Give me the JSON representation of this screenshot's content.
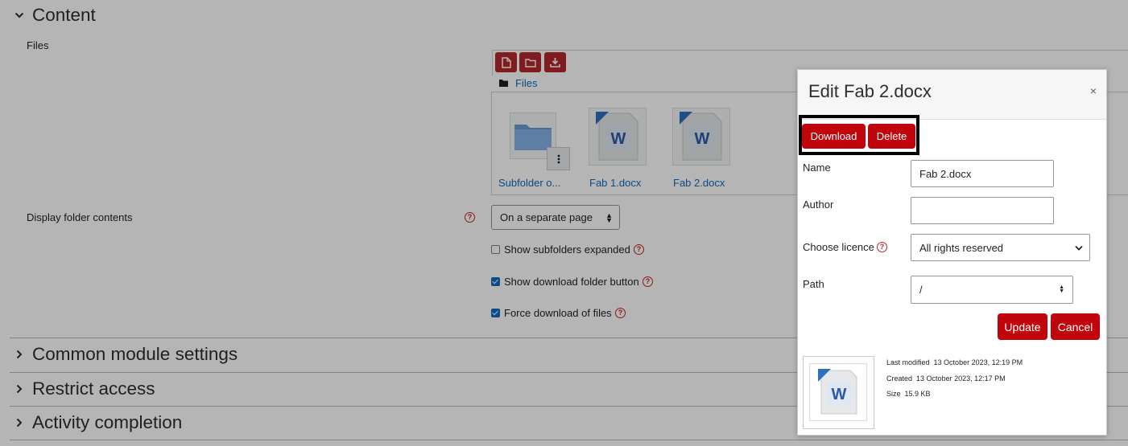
{
  "sections": {
    "content": "Content",
    "common": "Common module settings",
    "restrict": "Restrict access",
    "completion": "Activity completion"
  },
  "files_label": "Files",
  "filemanager": {
    "path": "Files",
    "items": [
      {
        "label": "Subfolder o...",
        "type": "folder"
      },
      {
        "label": "Fab 1.docx",
        "type": "docx"
      },
      {
        "label": "Fab 2.docx",
        "type": "docx"
      }
    ],
    "icons": [
      "add-file-icon",
      "create-folder-icon",
      "download-icon"
    ]
  },
  "display": {
    "label": "Display folder contents",
    "value": "On a separate page"
  },
  "checkboxes": [
    {
      "label": "Show subfolders expanded",
      "checked": false
    },
    {
      "label": "Show download folder button",
      "checked": true
    },
    {
      "label": "Force download of files",
      "checked": true
    }
  ],
  "dialog": {
    "title": "Edit Fab 2.docx",
    "close": "×",
    "download": "Download",
    "delete": "Delete",
    "name_label": "Name",
    "name_value": "Fab 2.docx",
    "author_label": "Author",
    "author_value": "",
    "licence_label": "Choose licence",
    "licence_value": "All rights reserved",
    "path_label": "Path",
    "path_value": "/",
    "update": "Update",
    "cancel": "Cancel",
    "meta": {
      "modified_label": "Last modified",
      "modified_value": "13 October 2023, 12:19 PM",
      "created_label": "Created",
      "created_value": "13 October 2023, 12:17 PM",
      "size_label": "Size",
      "size_value": "15.9 KB"
    }
  },
  "colors": {
    "accent_red": "#c0060c",
    "toolbar_red": "#b5272d",
    "link_blue": "#0f6cbf",
    "help_red": "#c0242b"
  }
}
